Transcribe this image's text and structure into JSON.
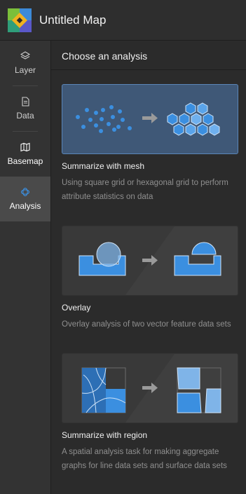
{
  "app": {
    "title": "Untitled Map"
  },
  "sidebar": {
    "items": [
      {
        "label": "Layer",
        "icon": "layers-icon"
      },
      {
        "label": "Data",
        "icon": "document-icon"
      },
      {
        "label": "Basemap",
        "icon": "map-icon"
      },
      {
        "label": "Analysis",
        "icon": "analysis-icon",
        "active": true
      }
    ]
  },
  "main": {
    "title": "Choose an analysis",
    "analyses": [
      {
        "title": "Summarize with mesh",
        "description": "Using square grid or hexagonal grid to perform attribute statistics on data",
        "selected": true
      },
      {
        "title": "Overlay",
        "description": "Overlay analysis of two vector feature data sets",
        "selected": false
      },
      {
        "title": "Summarize with region",
        "description": "A spatial analysis task for making aggregate graphs for line data sets and surface data sets",
        "selected": false
      }
    ]
  },
  "colors": {
    "accent": "#3b8fe0",
    "selected_card": "#3f5877",
    "text_muted": "#8f8f8f"
  }
}
